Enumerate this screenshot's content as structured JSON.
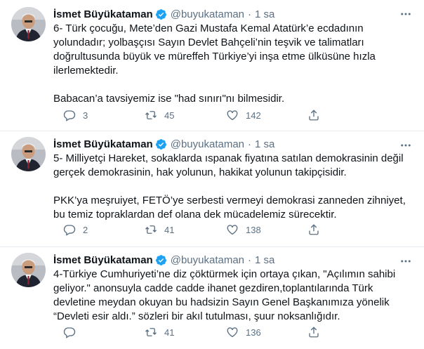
{
  "tweets": [
    {
      "name": "İsmet Büyükataman",
      "handle": "@buyukataman",
      "separator": "·",
      "time": "1 sa",
      "text": "6- Türk çocuğu, Mete’den Gazi Mustafa Kemal Atatürk’e ecdadının yolundadır; yolbaşçısı Sayın Devlet Bahçeli’nin teşvik ve talimatları doğrultusunda büyük ve müreffeh Türkiye’yi inşa etme ülküsüne hızla ilerlemektedir.\n\nBabacan’a tavsiyemiz ise \"had sınırı\"nı bilmesidir.",
      "replies": "3",
      "retweets": "45",
      "likes": "142"
    },
    {
      "name": "İsmet Büyükataman",
      "handle": "@buyukataman",
      "separator": "·",
      "time": "1 sa",
      "text": "5- Milliyetçi Hareket, sokaklarda ıspanak fiyatına satılan demokrasinin değil gerçek demokrasinin, hak yolunun, hakikat yolunun takipçisidir.\n\nPKK’ya meşruiyet, FETÖ’ye serbesti vermeyi demokrasi zanneden zihniyet, bu temiz topraklardan def olana dek mücadelemiz sürecektir.",
      "replies": "2",
      "retweets": "41",
      "likes": "138"
    },
    {
      "name": "İsmet Büyükataman",
      "handle": "@buyukataman",
      "separator": "·",
      "time": "1 sa",
      "text": "4-Türkiye Cumhuriyeti’ne diz çöktürmek için ortaya çıkan, \"Açılımın sahibi geliyor.\" anonsuyla cadde cadde ihanet gezdiren,toplantılarında Türk devletine meydan okuyan bu hadsizin Sayın Genel Başkanımıza yönelik “Devleti esir aldı.” sözleri bir akıl tutulması, şuur noksanlığıdır.",
      "replies": "",
      "retweets": "41",
      "likes": "136"
    }
  ],
  "colors": {
    "verified": "#1da1f2",
    "secondary_text": "#5b7083",
    "divider": "#e6ecf0"
  },
  "icons": [
    "verified-badge-icon",
    "more-options-icon",
    "reply-icon",
    "retweet-icon",
    "like-icon",
    "share-icon"
  ]
}
